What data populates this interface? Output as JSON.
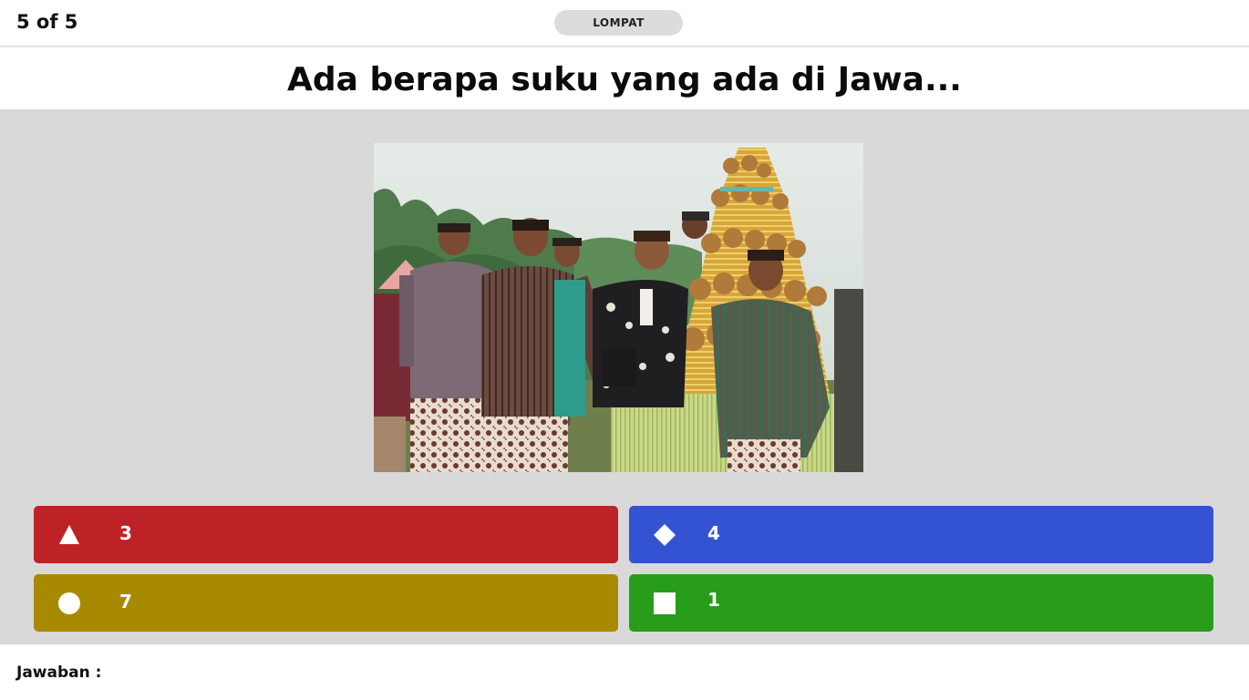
{
  "header": {
    "counter": "5 of 5",
    "skip_label": "LOMPAT"
  },
  "question": {
    "text": "Ada berapa suku yang ada di Jawa..."
  },
  "image": {
    "subject": "Javanese men in traditional lurik attire and blangkon headwear beside a gunungan offering"
  },
  "answers": [
    {
      "shape": "triangle-icon",
      "label": "3",
      "color": "#bd2326"
    },
    {
      "shape": "diamond-icon",
      "label": "4",
      "color": "#3453d3"
    },
    {
      "shape": "circle-icon",
      "label": "7",
      "color": "#a88a02"
    },
    {
      "shape": "square-icon",
      "label": "1",
      "color": "#279d1b"
    }
  ],
  "footer": {
    "answer_label": "Jawaban :"
  }
}
